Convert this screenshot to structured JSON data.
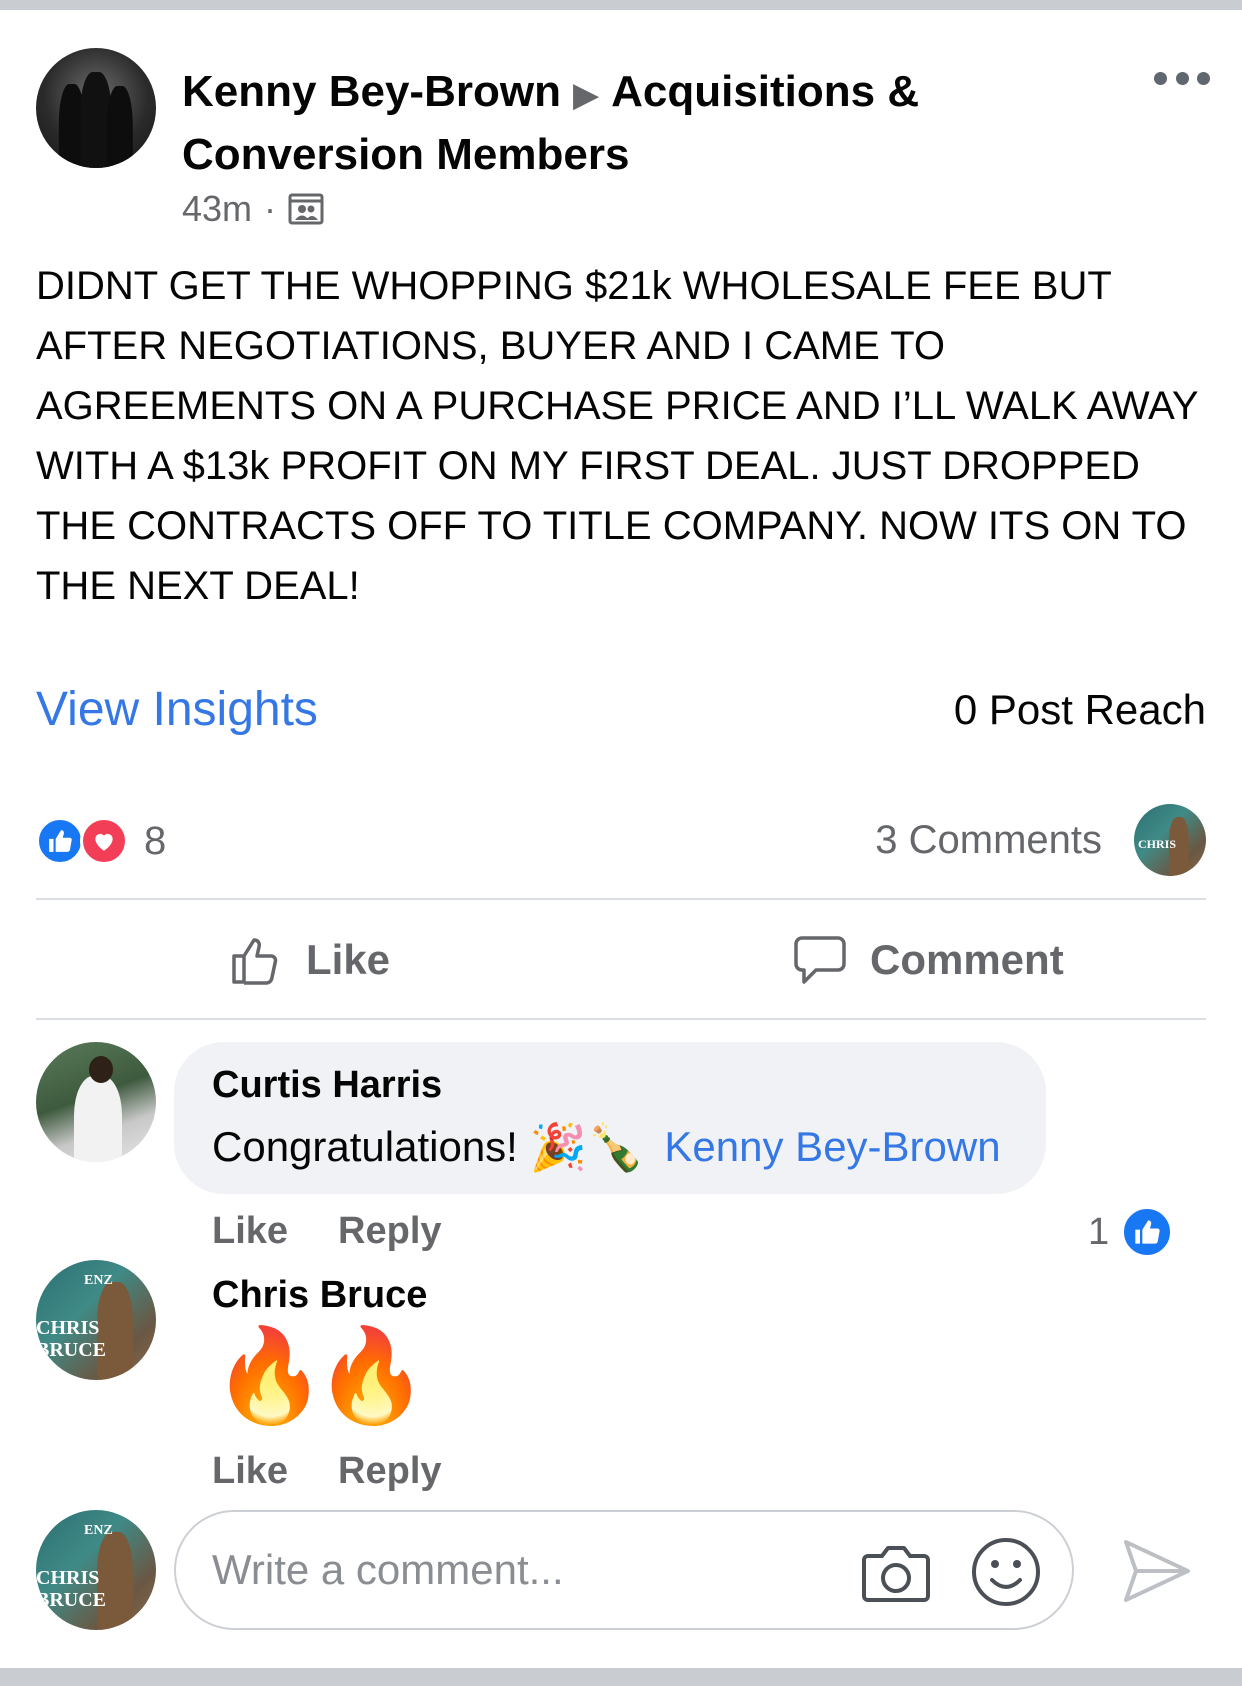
{
  "post": {
    "author": "Kenny Bey-Brown",
    "group": "Acquisitions & Conversion  Members",
    "time": "43m",
    "separator": "·",
    "text": "DIDNT GET THE WHOPPING $21k WHOLESALE FEE BUT AFTER NEGOTIATIONS, BUYER AND I CAME TO AGREEMENTS ON A PURCHASE PRICE AND I’LL WALK AWAY WITH A $13k PROFIT ON MY FIRST DEAL. JUST DROPPED THE CONTRACTS OFF TO TITLE COMPANY. NOW ITS ON TO THE NEXT DEAL!"
  },
  "insights": {
    "view_label": "View Insights",
    "reach": "0 Post Reach"
  },
  "stats": {
    "reaction_count": "8",
    "comments": "3 Comments"
  },
  "actions": {
    "like": "Like",
    "comment": "Comment"
  },
  "comments": [
    {
      "name": "Curtis Harris",
      "text": "Congratulations!",
      "emoji": "🎉🍾",
      "mention": "Kenny Bey-Brown",
      "like": "Like",
      "reply": "Reply",
      "like_count": "1"
    },
    {
      "name": "Chris Bruce",
      "emoji_1": "🔥",
      "emoji_2": "🔥",
      "like": "Like",
      "reply": "Reply",
      "avatar_text_1": "CHRIS",
      "avatar_text_2": "BRUCE",
      "avatar_logo": "ENZ"
    }
  ],
  "composer": {
    "placeholder": "Write a comment..."
  },
  "colors": {
    "link": "#3578e5",
    "secondary_text": "#65676b",
    "like_blue": "#1877f2",
    "love_red": "#f33e58",
    "bubble_bg": "#f0f2f5"
  }
}
